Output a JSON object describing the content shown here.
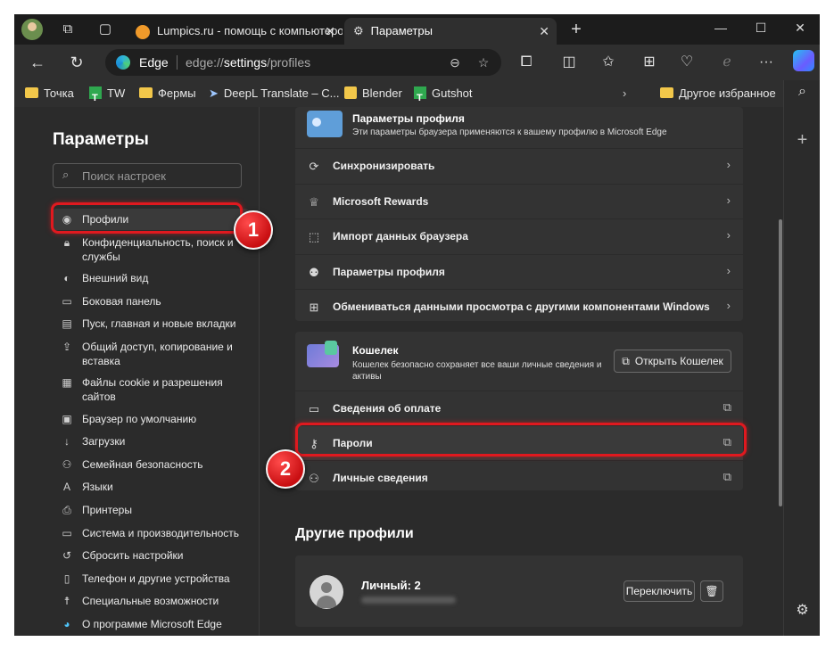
{
  "browser": {
    "tabs": [
      {
        "title": "Lumpics.ru - помощь с компьютером"
      },
      {
        "title": "Параметры"
      }
    ],
    "brand": "Edge",
    "url_prefix": "edge://",
    "url_bold": "settings",
    "url_suffix": "/profiles"
  },
  "favorites": [
    {
      "label": "Точка",
      "icon": "folder-icon"
    },
    {
      "label": "TW",
      "icon": "green-favicon"
    },
    {
      "label": "Фермы",
      "icon": "folder-icon"
    },
    {
      "label": "DeepL Translate – С...",
      "icon": "deepl-icon"
    },
    {
      "label": "Blender",
      "icon": "blender-icon"
    },
    {
      "label": "Gutshot",
      "icon": "green-favicon"
    },
    {
      "label": "Другое избранное",
      "icon": "folder-icon"
    }
  ],
  "sidebar": {
    "title": "Параметры",
    "search_placeholder": "Поиск настроек",
    "items": [
      {
        "label": "Профили",
        "icon": "profile-icon"
      },
      {
        "label": "Конфиденциальность, поиск и службы",
        "icon": "lock-icon"
      },
      {
        "label": "Внешний вид",
        "icon": "palette-icon"
      },
      {
        "label": "Боковая панель",
        "icon": "sidebar-icon"
      },
      {
        "label": "Пуск, главная и новые вкладки",
        "icon": "home-icon"
      },
      {
        "label": "Общий доступ, копирование и вставка",
        "icon": "share-icon"
      },
      {
        "label": "Файлы cookie и разрешения сайтов",
        "icon": "cookie-icon"
      },
      {
        "label": "Браузер по умолчанию",
        "icon": "browser-icon"
      },
      {
        "label": "Загрузки",
        "icon": "download-icon"
      },
      {
        "label": "Семейная безопасность",
        "icon": "family-icon"
      },
      {
        "label": "Языки",
        "icon": "language-icon"
      },
      {
        "label": "Принтеры",
        "icon": "printer-icon"
      },
      {
        "label": "Система и производительность",
        "icon": "system-icon"
      },
      {
        "label": "Сбросить настройки",
        "icon": "reset-icon"
      },
      {
        "label": "Телефон и другие устройства",
        "icon": "phone-icon"
      },
      {
        "label": "Специальные возможности",
        "icon": "accessibility-icon"
      },
      {
        "label": "О программе Microsoft Edge",
        "icon": "edge-icon"
      }
    ]
  },
  "profile_card": {
    "title": "Параметры профиля",
    "subtitle": "Эти параметры браузера применяются к вашему профилю в Microsoft Edge",
    "rows": [
      {
        "label": "Синхронизировать",
        "icon": "sync-icon"
      },
      {
        "label": "Microsoft Rewards",
        "icon": "trophy-icon"
      },
      {
        "label": "Импорт данных браузера",
        "icon": "import-icon"
      },
      {
        "label": "Параметры профиля",
        "icon": "profile-settings-icon"
      },
      {
        "label": "Обмениваться данными просмотра с другими компонентами Windows",
        "icon": "windows-icon"
      }
    ]
  },
  "wallet_card": {
    "title": "Кошелек",
    "subtitle": "Кошелек безопасно сохраняет все ваши личные сведения и активы",
    "open_button": "Открыть Кошелек",
    "rows": [
      {
        "label": "Сведения об оплате",
        "icon": "card-icon"
      },
      {
        "label": "Пароли",
        "icon": "key-icon"
      },
      {
        "label": "Личные сведения",
        "icon": "person-icon"
      }
    ]
  },
  "other_profiles": {
    "title": "Другие профили",
    "profile_name": "Личный: 2",
    "switch_button": "Переключить"
  },
  "annotations": {
    "badge1": "1",
    "badge2": "2",
    "color": "#e0191f"
  }
}
